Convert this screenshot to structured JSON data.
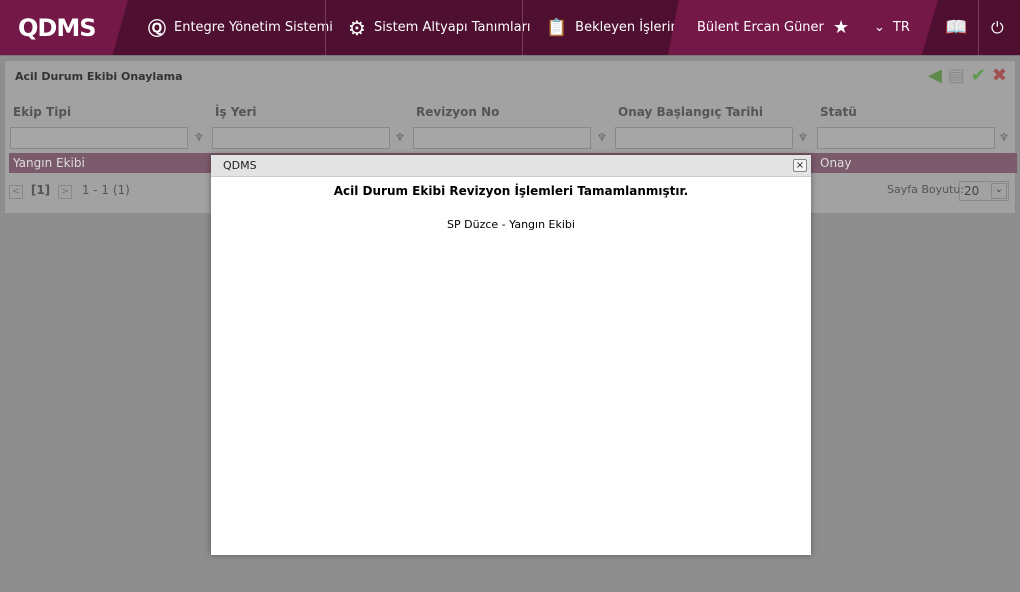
{
  "header": {
    "logo": "QDMS",
    "nav": [
      "Entegre Yönetim Sistemi",
      "Sistem Altyapı Tanımları",
      "Bekleyen İşlerim"
    ],
    "user": "Bülent Ercan Güner",
    "lang": "TR"
  },
  "page": {
    "title": "Acil Durum Ekibi Onaylama",
    "columns": [
      "Ekip Tipi",
      "İş Yeri",
      "Revizyon No",
      "Onay Başlangıç Tarihi",
      "Statü"
    ],
    "row": {
      "ekip_tipi": "Yangın Ekibi",
      "statu": "Onay"
    },
    "pager": {
      "current": "[1]",
      "range": "1 - 1 (1)",
      "size_label": "Sayfa Boyutu:",
      "size": "20"
    }
  },
  "modal": {
    "title": "QDMS",
    "close": "×",
    "message": "Acil Durum Ekibi Revizyon İşlemleri Tamamlanmıştır.",
    "detail": "SP Düzce - Yangın Ekibi"
  }
}
